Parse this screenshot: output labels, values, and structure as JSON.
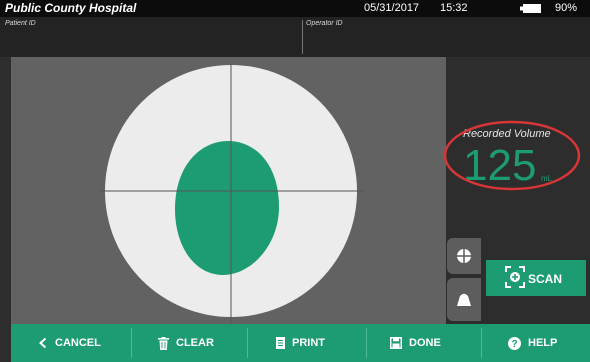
{
  "status_bar": {
    "hospital": "Public County Hospital",
    "date": "05/31/2017",
    "time": "15:32",
    "battery": "90%",
    "battery_level": 0.9
  },
  "id_bar": {
    "patient_label": "Patient ID",
    "operator_label": "Operator ID"
  },
  "volume": {
    "label": "Recorded Volume",
    "value": "125",
    "unit": "mL"
  },
  "scan_button": {
    "label": "SCAN"
  },
  "toolbar": {
    "cancel": "CANCEL",
    "clear": "CLEAR",
    "print": "PRINT",
    "done": "DONE",
    "help": "HELP"
  },
  "colors": {
    "accent": "#1d9c73",
    "highlight_ring": "#d63636",
    "target_disc": "#ececec",
    "bladder": "#1d9c73"
  },
  "icons": [
    "battery-icon",
    "crosshair-icon",
    "probe-icon",
    "scan-icon",
    "chevron-left-icon",
    "trash-icon",
    "print-icon",
    "save-icon",
    "help-icon"
  ]
}
